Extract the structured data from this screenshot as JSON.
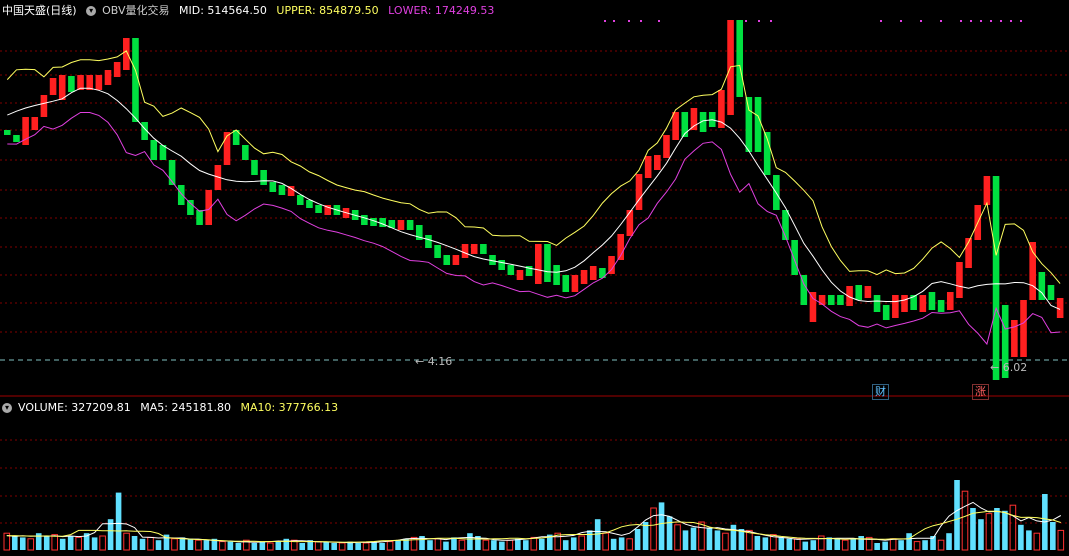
{
  "header": {
    "stock_name": "中国天盛(日线)",
    "indicator_name": "OBV量化交易",
    "mid": "MID: 514564.50",
    "upper": "UPPER: 854879.50",
    "lower": "LOWER: 174249.53"
  },
  "volume_header": {
    "volume": "VOLUME: 327209.81",
    "ma5": "MA5: 245181.80",
    "ma10": "MA10: 377766.13"
  },
  "markers": {
    "low_label": "4.16",
    "last_label": "6.02",
    "tag_cai": "财",
    "tag_zhang": "涨"
  },
  "colors": {
    "up": "#ff2020",
    "down": "#00e040",
    "upper": "#ffff60",
    "mid": "#ffffff",
    "lower": "#e040e0",
    "volume_down": "#60e0ff",
    "volume_up": "#ff3030",
    "grid": "#800000"
  },
  "chart_data": [
    {
      "type": "candlestick",
      "title": "OBV量化交易",
      "series_names": [
        "MID",
        "UPPER",
        "LOWER"
      ],
      "candles": [
        [
          0,
          130,
          135
        ],
        [
          0,
          135,
          142
        ],
        [
          1,
          117,
          145
        ],
        [
          1,
          117,
          130
        ],
        [
          1,
          95,
          117
        ],
        [
          1,
          78,
          95
        ],
        [
          1,
          75,
          100
        ],
        [
          0,
          76,
          92
        ],
        [
          1,
          75,
          90
        ],
        [
          1,
          75,
          90
        ],
        [
          1,
          75,
          90
        ],
        [
          1,
          70,
          85
        ],
        [
          1,
          62,
          77
        ],
        [
          1,
          38,
          70
        ],
        [
          0,
          38,
          122
        ],
        [
          0,
          122,
          140
        ],
        [
          0,
          140,
          160
        ],
        [
          0,
          145,
          160
        ],
        [
          0,
          160,
          185
        ],
        [
          0,
          185,
          205
        ],
        [
          0,
          200,
          215
        ],
        [
          0,
          210,
          225
        ],
        [
          1,
          190,
          225
        ],
        [
          1,
          165,
          190
        ],
        [
          1,
          132,
          165
        ],
        [
          0,
          130,
          145
        ],
        [
          0,
          145,
          160
        ],
        [
          0,
          160,
          175
        ],
        [
          0,
          170,
          185
        ],
        [
          0,
          182,
          192
        ],
        [
          0,
          185,
          195
        ],
        [
          1,
          186,
          196
        ],
        [
          0,
          195,
          205
        ],
        [
          0,
          200,
          208
        ],
        [
          0,
          205,
          213
        ],
        [
          1,
          205,
          215
        ],
        [
          0,
          205,
          215
        ],
        [
          1,
          208,
          218
        ],
        [
          0,
          210,
          220
        ],
        [
          0,
          215,
          225
        ],
        [
          0,
          218,
          226
        ],
        [
          0,
          218,
          227
        ],
        [
          0,
          220,
          228
        ],
        [
          1,
          220,
          230
        ],
        [
          0,
          220,
          230
        ],
        [
          0,
          225,
          240
        ],
        [
          0,
          235,
          248
        ],
        [
          0,
          245,
          258
        ],
        [
          0,
          255,
          265
        ],
        [
          1,
          255,
          265
        ],
        [
          1,
          244,
          258
        ],
        [
          1,
          244,
          254
        ],
        [
          0,
          244,
          254
        ],
        [
          0,
          255,
          265
        ],
        [
          0,
          260,
          270
        ],
        [
          0,
          265,
          275
        ],
        [
          1,
          270,
          280
        ],
        [
          0,
          266,
          276
        ],
        [
          1,
          244,
          284
        ],
        [
          0,
          244,
          282
        ],
        [
          0,
          265,
          285
        ],
        [
          0,
          275,
          292
        ],
        [
          1,
          275,
          292
        ],
        [
          1,
          270,
          284
        ],
        [
          1,
          266,
          280
        ],
        [
          0,
          268,
          278
        ],
        [
          1,
          256,
          274
        ],
        [
          1,
          234,
          260
        ],
        [
          1,
          210,
          236
        ],
        [
          1,
          174,
          210
        ],
        [
          1,
          156,
          178
        ],
        [
          1,
          155,
          170
        ],
        [
          1,
          135,
          158
        ],
        [
          1,
          112,
          140
        ],
        [
          0,
          112,
          137
        ],
        [
          1,
          108,
          130
        ],
        [
          0,
          112,
          132
        ],
        [
          0,
          112,
          127
        ],
        [
          1,
          90,
          128
        ],
        [
          1,
          20,
          115
        ],
        [
          0,
          20,
          97
        ],
        [
          0,
          97,
          152
        ],
        [
          0,
          97,
          152
        ],
        [
          0,
          132,
          175
        ],
        [
          0,
          175,
          210
        ],
        [
          0,
          210,
          240
        ],
        [
          0,
          240,
          275
        ],
        [
          0,
          275,
          305
        ],
        [
          1,
          292,
          322
        ],
        [
          1,
          295,
          305
        ],
        [
          0,
          295,
          305
        ],
        [
          0,
          295,
          305
        ],
        [
          1,
          286,
          306
        ],
        [
          0,
          285,
          300
        ],
        [
          1,
          286,
          298
        ],
        [
          0,
          295,
          312
        ],
        [
          0,
          305,
          320
        ],
        [
          1,
          295,
          318
        ],
        [
          1,
          295,
          312
        ],
        [
          0,
          295,
          310
        ],
        [
          1,
          295,
          312
        ],
        [
          0,
          292,
          310
        ],
        [
          0,
          300,
          312
        ],
        [
          1,
          292,
          310
        ],
        [
          1,
          262,
          298
        ],
        [
          1,
          238,
          268
        ],
        [
          1,
          205,
          240
        ],
        [
          1,
          176,
          205
        ],
        [
          0,
          176,
          380
        ],
        [
          0,
          305,
          378
        ],
        [
          1,
          320,
          357
        ],
        [
          1,
          300,
          357
        ],
        [
          1,
          242,
          300
        ],
        [
          0,
          272,
          300
        ],
        [
          0,
          285,
          300
        ],
        [
          1,
          298,
          318
        ]
      ],
      "candle_format": "[is_up, open_close_top, open_close_bottom] in price-pane units"
    },
    {
      "type": "bar",
      "title": "VOLUME",
      "series_names": [
        "VOLUME",
        "MA5",
        "MA10"
      ],
      "values": [
        0.12,
        0.1,
        0.09,
        0.08,
        0.12,
        0.1,
        0.11,
        0.08,
        0.1,
        0.09,
        0.12,
        0.09,
        0.1,
        0.22,
        0.41,
        0.12,
        0.1,
        0.08,
        0.09,
        0.07,
        0.11,
        0.08,
        0.09,
        0.08,
        0.07,
        0.07,
        0.08,
        0.06,
        0.06,
        0.05,
        0.07,
        0.05,
        0.06,
        0.05,
        0.06,
        0.08,
        0.07,
        0.05,
        0.07,
        0.06,
        0.06,
        0.05,
        0.05,
        0.06,
        0.05,
        0.05,
        0.06,
        0.05,
        0.06,
        0.07,
        0.08,
        0.09,
        0.1,
        0.07,
        0.08,
        0.06,
        0.09,
        0.07,
        0.12,
        0.1,
        0.07,
        0.07,
        0.06,
        0.07,
        0.08,
        0.07,
        0.09,
        0.08,
        0.11,
        0.12,
        0.07,
        0.09,
        0.1,
        0.14,
        0.22,
        0.12,
        0.08,
        0.09,
        0.08,
        0.15,
        0.2,
        0.3,
        0.34,
        0.24,
        0.18,
        0.14,
        0.16,
        0.2,
        0.16,
        0.14,
        0.12,
        0.18,
        0.15,
        0.14,
        0.1,
        0.09,
        0.11,
        0.09,
        0.08,
        0.08,
        0.06,
        0.07,
        0.1,
        0.09,
        0.08,
        0.07,
        0.08,
        0.1,
        0.09,
        0.05,
        0.06,
        0.08,
        0.07,
        0.12,
        0.06,
        0.07,
        0.1,
        0.07,
        0.12,
        0.5,
        0.42,
        0.3,
        0.22,
        0.26,
        0.3,
        0.28,
        0.32,
        0.18,
        0.14,
        0.12,
        0.4,
        0.2,
        0.14
      ],
      "value_units": "fraction of volume pane height"
    }
  ]
}
